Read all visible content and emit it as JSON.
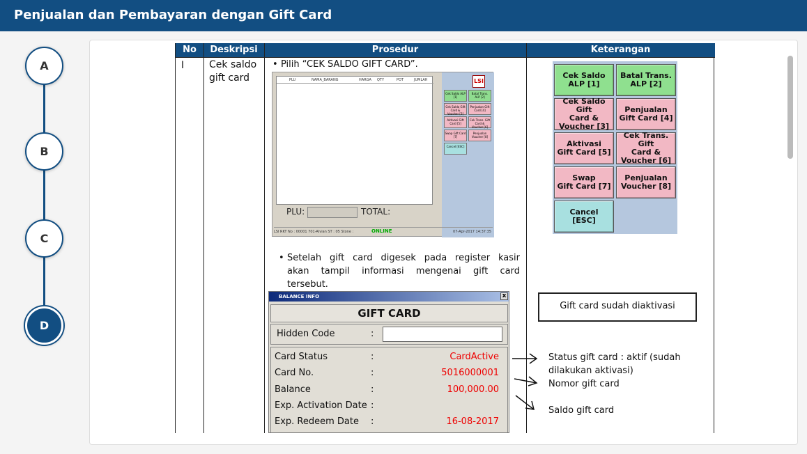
{
  "header": {
    "title": "Penjualan dan Pembayaran dengan Gift Card"
  },
  "steps": [
    "A",
    "B",
    "C",
    "D"
  ],
  "table": {
    "headers": [
      "No",
      "Deskripsi",
      "Prosedur",
      "Keterangan"
    ],
    "row": {
      "no": "I",
      "desc_line1": "Cek saldo",
      "desc_line2": "gift card",
      "bullet1": "Pilih “CEK SALDO GIFT CARD”.",
      "bullet2_l1": "Setelah gift card digesek pada register kasir",
      "bullet2_l2": "akan tampil informasi mengenai gift card",
      "bullet2_l3": "tersebut."
    }
  },
  "pos": {
    "columns": [
      "PLU",
      "NAMA_BARANG",
      "HARGA",
      "QTY",
      "POT",
      "JUMLAH"
    ],
    "plu_label": "PLU:",
    "total_label": "TOTAL:",
    "status_left": "LSI RKT  No : 00001  701-Alvian  ST : 05  Stone :",
    "status_online": "ONLINE",
    "status_right": "07-Apr-2017 14:37:35",
    "logo": "LSI",
    "mini_buttons": [
      {
        "label": "Cek Saldo ALP [1]",
        "color": "g"
      },
      {
        "label": "Batal Trans. ALP [2]",
        "color": "g"
      },
      {
        "label": "Cek Saldo Gift Card & Voucher [3]",
        "color": "p"
      },
      {
        "label": "Penjualan Gift Card [4]",
        "color": "p"
      },
      {
        "label": "Aktivasi Gift Card [5]",
        "color": "p"
      },
      {
        "label": "Cek Trans. Gift Card & Voucher [6]",
        "color": "p"
      },
      {
        "label": "Swap Gift Card [7]",
        "color": "p"
      },
      {
        "label": "Penjualan Voucher [8]",
        "color": "p"
      },
      {
        "label": "Cancel [ESC]",
        "color": "c"
      }
    ]
  },
  "keterangan_buttons": [
    {
      "l1": "Cek Saldo",
      "l2": "ALP [1]",
      "l3": "",
      "color": "g"
    },
    {
      "l1": "Batal Trans.",
      "l2": "ALP [2]",
      "l3": "",
      "color": "g"
    },
    {
      "l1": "Cek Saldo Gift",
      "l2": "Card &",
      "l3": "Voucher [3]",
      "color": "p"
    },
    {
      "l1": "Penjualan",
      "l2": "Gift Card [4]",
      "l3": "",
      "color": "p"
    },
    {
      "l1": "Aktivasi",
      "l2": "Gift Card [5]",
      "l3": "",
      "color": "p"
    },
    {
      "l1": "Cek Trans. Gift",
      "l2": "Card &",
      "l3": "Voucher [6]",
      "color": "p"
    },
    {
      "l1": "Swap",
      "l2": "Gift Card [7]",
      "l3": "",
      "color": "p"
    },
    {
      "l1": "Penjualan",
      "l2": "Voucher [8]",
      "l3": "",
      "color": "p"
    },
    {
      "l1": "Cancel",
      "l2": "[ESC]",
      "l3": "",
      "color": "c"
    }
  ],
  "balance": {
    "window_title": "BALANCE INFO",
    "close": "x",
    "heading": "GIFT CARD",
    "hidden_code_label": "Hidden Code",
    "colon": ":",
    "rows": [
      {
        "label": "Card Status",
        "value": "CardActive"
      },
      {
        "label": "Card No.",
        "value": "5016000001"
      },
      {
        "label": "Balance",
        "value": "100,000.00"
      },
      {
        "label": "Exp. Activation Date",
        "value": ""
      },
      {
        "label": "Exp. Redeem Date",
        "value": "16-08-2017"
      }
    ]
  },
  "notes": {
    "box": "Gift card sudah diaktivasi",
    "status_l1": "Status gift card : aktif (sudah",
    "status_l2": "dilakukan aktivasi)",
    "nomor": "Nomor gift card",
    "saldo": "Saldo gift card"
  },
  "colors": {
    "primary": "#124e82",
    "value_red": "#e00000",
    "panel_blue": "#b5c7de"
  }
}
